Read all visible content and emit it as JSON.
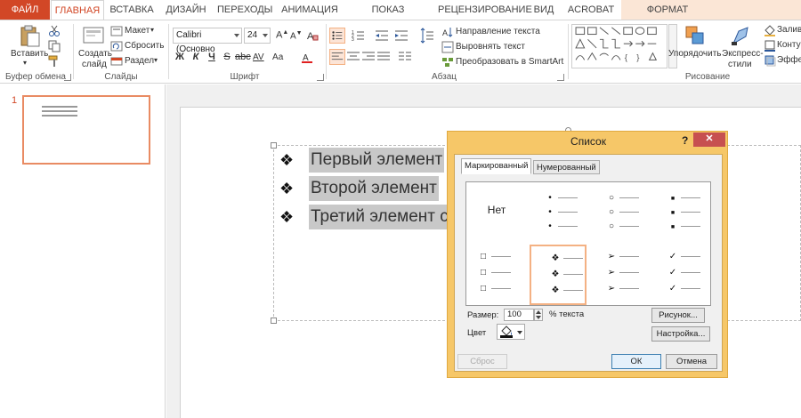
{
  "tabs": [
    "ФАЙЛ",
    "ГЛАВНАЯ",
    "ВСТАВКА",
    "ДИЗАЙН",
    "ПЕРЕХОДЫ",
    "АНИМАЦИЯ",
    "ПОКАЗ СЛАЙДОВ",
    "РЕЦЕНЗИРОВАНИЕ",
    "ВИД",
    "ACROBAT",
    "ФОРМАТ"
  ],
  "ribbon": {
    "clipboard": {
      "paste": "Вставить",
      "label": "Буфер обмена"
    },
    "slides": {
      "new_slide_1": "Создать",
      "new_slide_2": "слайд",
      "layout": "Макет",
      "reset": "Сбросить",
      "section": "Раздел",
      "label": "Слайды"
    },
    "font": {
      "family": "Calibri (Основно",
      "size": "24",
      "bold": "Ж",
      "italic": "К",
      "underline": "Ч",
      "strike": "S",
      "spacing": "AV",
      "case": "Аа",
      "label": "Шрифт"
    },
    "paragraph": {
      "text_direction": "Направление текста",
      "align_text": "Выровнять текст",
      "smartart": "Преобразовать в SmartArt",
      "label": "Абзац"
    },
    "drawing": {
      "arrange": "Упорядочить",
      "styles_1": "Экспресс-",
      "styles_2": "стили",
      "fill": "Залив",
      "outline": "Контур",
      "effects": "Эффек",
      "label": "Рисование"
    }
  },
  "thumb": {
    "number": "1"
  },
  "slide": {
    "bullets": [
      {
        "glyph": "❖",
        "text": "Первый элемент"
      },
      {
        "glyph": "❖",
        "text": "Второй элемент"
      },
      {
        "glyph": "❖",
        "text": "Третий элемент с"
      }
    ]
  },
  "dialog": {
    "title": "Список",
    "help": "?",
    "close": "✕",
    "tabs": [
      "Маркированный",
      "Нумерованный"
    ],
    "none_label": "Нет",
    "size_label": "Размер:",
    "size_value": "100",
    "percent_label": "% текста",
    "color_label": "Цвет",
    "picture_btn": "Рисунок...",
    "customize_btn": "Настройка...",
    "reset_btn": "Сброс",
    "ok_btn": "ОК",
    "cancel_btn": "Отмена",
    "bullet_glyphs": [
      "•",
      "○",
      "■",
      "□",
      "❖",
      "➢",
      "✓"
    ]
  }
}
